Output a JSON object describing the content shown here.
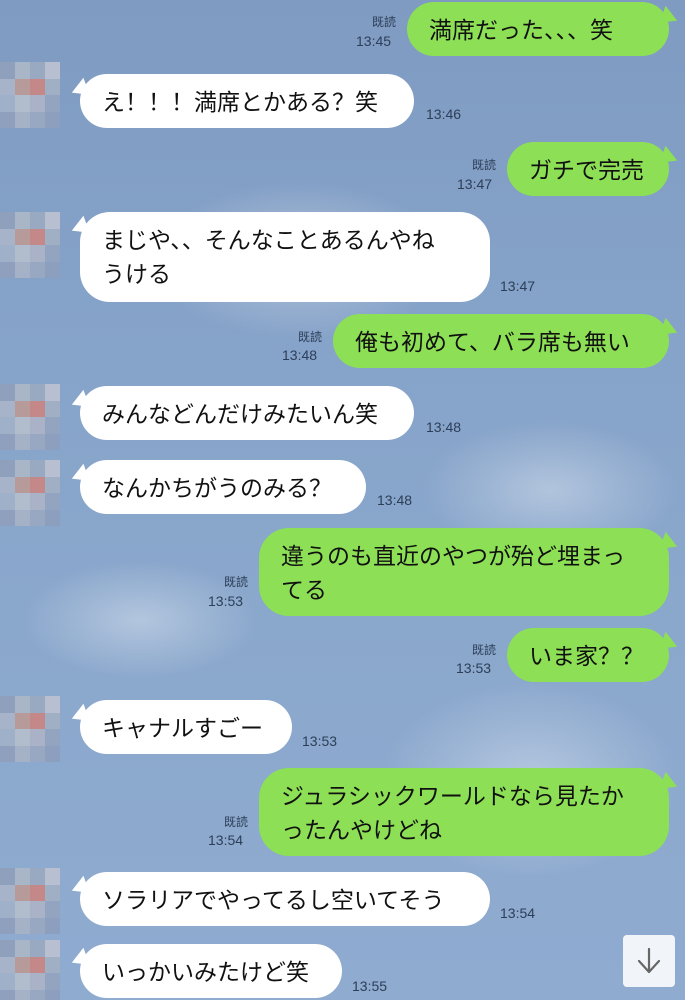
{
  "chat": {
    "messages": [
      {
        "side": "out",
        "text": "満席だった、、、笑",
        "time": "13:45",
        "read": "既読"
      },
      {
        "side": "in",
        "text": "え！！！満席とかある？笑",
        "time": "13:46"
      },
      {
        "side": "out",
        "text": "ガチで完売",
        "time": "13:47",
        "read": "既読"
      },
      {
        "side": "in",
        "text": "まじや、、そんなことあるんやね\nうける",
        "time": "13:47"
      },
      {
        "side": "out",
        "text": "俺も初めて、バラ席も無い",
        "time": "13:48",
        "read": "既読"
      },
      {
        "side": "in",
        "text": "みんなどんだけみたいん笑",
        "time": "13:48"
      },
      {
        "side": "in",
        "text": "なんかちがうのみる？",
        "time": "13:48"
      },
      {
        "side": "out",
        "text": "違うのも直近のやつが殆ど埋まっ\nてる",
        "time": "13:53",
        "read": "既読"
      },
      {
        "side": "out",
        "text": "いま家？？",
        "time": "13:53",
        "read": "既読"
      },
      {
        "side": "in",
        "text": "キャナルすごー",
        "time": "13:53"
      },
      {
        "side": "out",
        "text": "ジュラシックワールドなら見たか\nったんやけどね",
        "time": "13:54",
        "read": "既読"
      },
      {
        "side": "in",
        "text": "ソラリアでやってるし空いてそう",
        "time": "13:54"
      },
      {
        "side": "in",
        "text": "いっかいみたけど笑",
        "time": "13:55"
      }
    ]
  },
  "scroll_button": {
    "icon": "arrow-down-icon"
  },
  "colors": {
    "out_bubble": "#8de055",
    "in_bubble": "#ffffff",
    "background": "#86a3c9"
  }
}
